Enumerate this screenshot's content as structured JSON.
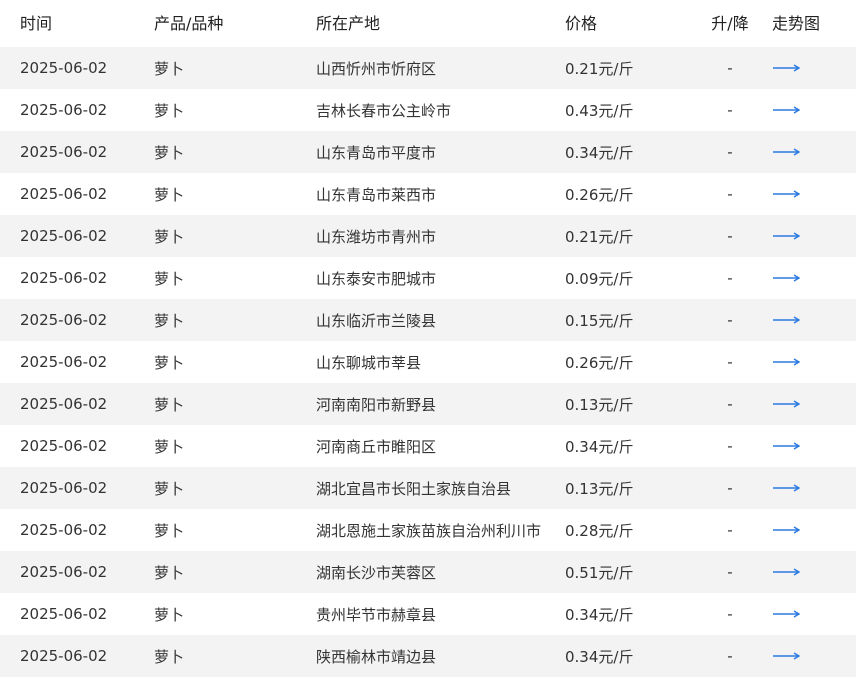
{
  "headers": {
    "date": "时间",
    "product": "产品/品种",
    "origin": "所在产地",
    "price": "价格",
    "change": "升/降",
    "trend": "走势图"
  },
  "rows": [
    {
      "date": "2025-06-02",
      "product": "萝卜",
      "origin": "山西忻州市忻府区",
      "price": "0.21元/斤",
      "change": "-"
    },
    {
      "date": "2025-06-02",
      "product": "萝卜",
      "origin": "吉林长春市公主岭市",
      "price": "0.43元/斤",
      "change": "-"
    },
    {
      "date": "2025-06-02",
      "product": "萝卜",
      "origin": "山东青岛市平度市",
      "price": "0.34元/斤",
      "change": "-"
    },
    {
      "date": "2025-06-02",
      "product": "萝卜",
      "origin": "山东青岛市莱西市",
      "price": "0.26元/斤",
      "change": "-"
    },
    {
      "date": "2025-06-02",
      "product": "萝卜",
      "origin": "山东潍坊市青州市",
      "price": "0.21元/斤",
      "change": "-"
    },
    {
      "date": "2025-06-02",
      "product": "萝卜",
      "origin": "山东泰安市肥城市",
      "price": "0.09元/斤",
      "change": "-"
    },
    {
      "date": "2025-06-02",
      "product": "萝卜",
      "origin": "山东临沂市兰陵县",
      "price": "0.15元/斤",
      "change": "-"
    },
    {
      "date": "2025-06-02",
      "product": "萝卜",
      "origin": "山东聊城市莘县",
      "price": "0.26元/斤",
      "change": "-"
    },
    {
      "date": "2025-06-02",
      "product": "萝卜",
      "origin": "河南南阳市新野县",
      "price": "0.13元/斤",
      "change": "-"
    },
    {
      "date": "2025-06-02",
      "product": "萝卜",
      "origin": "河南商丘市睢阳区",
      "price": "0.34元/斤",
      "change": "-"
    },
    {
      "date": "2025-06-02",
      "product": "萝卜",
      "origin": "湖北宜昌市长阳土家族自治县",
      "price": "0.13元/斤",
      "change": "-"
    },
    {
      "date": "2025-06-02",
      "product": "萝卜",
      "origin": "湖北恩施土家族苗族自治州利川市",
      "price": "0.28元/斤",
      "change": "-"
    },
    {
      "date": "2025-06-02",
      "product": "萝卜",
      "origin": "湖南长沙市芙蓉区",
      "price": "0.51元/斤",
      "change": "-"
    },
    {
      "date": "2025-06-02",
      "product": "萝卜",
      "origin": "贵州毕节市赫章县",
      "price": "0.34元/斤",
      "change": "-"
    },
    {
      "date": "2025-06-02",
      "product": "萝卜",
      "origin": "陕西榆林市靖边县",
      "price": "0.34元/斤",
      "change": "-"
    }
  ],
  "trend_icon": "arrow-right-icon",
  "colors": {
    "stripe": "#f3f3f3",
    "arrow": "#2a7ae2",
    "text": "#333333"
  }
}
